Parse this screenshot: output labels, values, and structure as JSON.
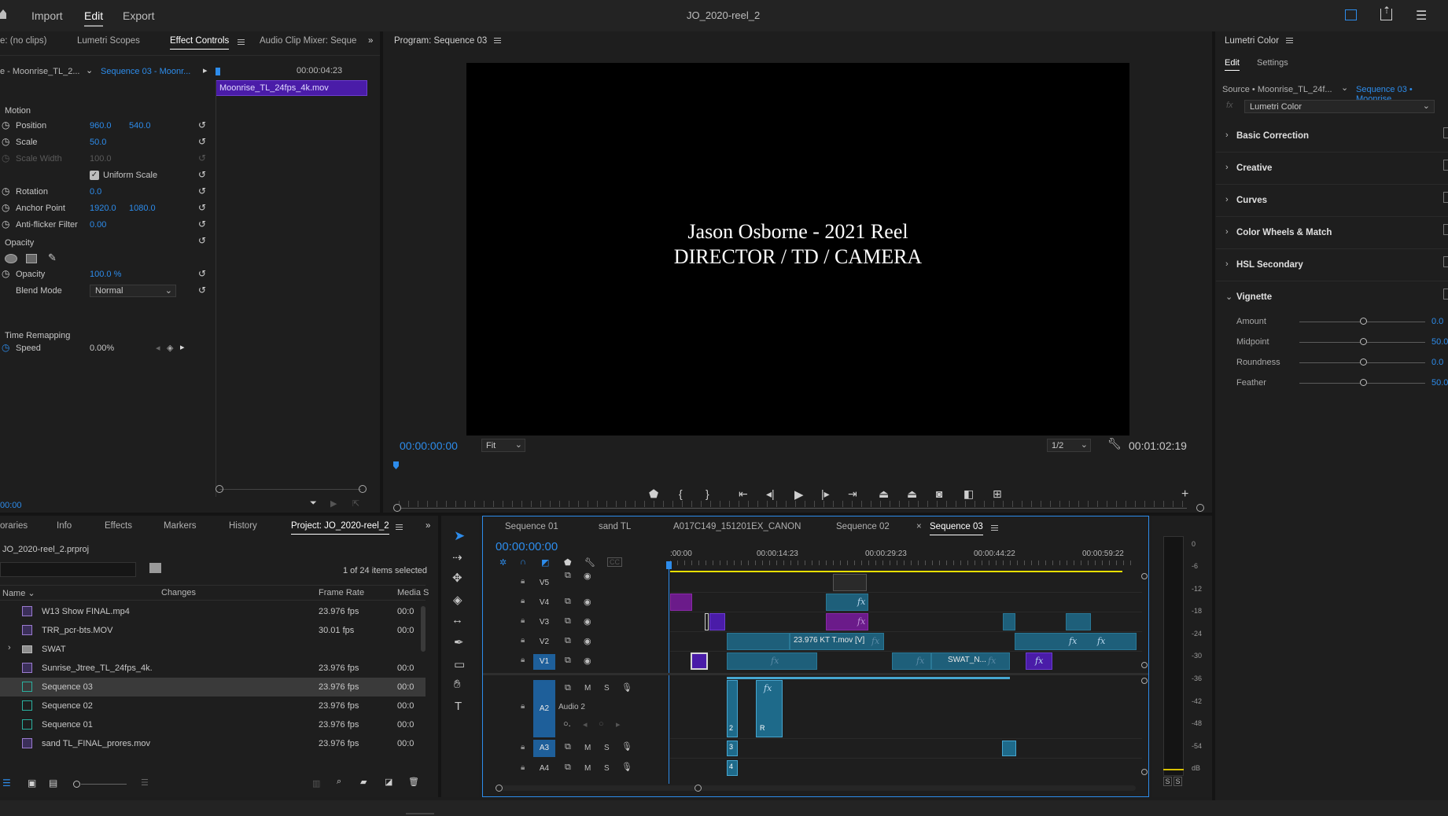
{
  "window": {
    "title": "JO_2020-reel_2",
    "nav": [
      "Import",
      "Edit",
      "Export"
    ],
    "active_nav": "Edit"
  },
  "effect_controls": {
    "tabs": [
      "e: (no clips)",
      "Lumetri Scopes",
      "Effect Controls",
      "Audio Clip Mixer: Seque"
    ],
    "source_label": "e - Moonrise_TL_2...",
    "sequence_label": "Sequence 03 - Moonr...",
    "timecode_header": "00:00:04:23",
    "clip_name": "Moonrise_TL_24fps_4k.mov",
    "motion_label": "Motion",
    "position_label": "Position",
    "position_x": "960.0",
    "position_y": "540.0",
    "scale_label": "Scale",
    "scale_value": "50.0",
    "scale_width_label": "Scale Width",
    "scale_width_value": "100.0",
    "uniform_scale_label": "Uniform Scale",
    "rotation_label": "Rotation",
    "rotation_value": "0.0",
    "anchor_label": "Anchor Point",
    "anchor_x": "1920.0",
    "anchor_y": "1080.0",
    "antiflicker_label": "Anti-flicker Filter",
    "antiflicker_value": "0.00",
    "opacity_section": "Opacity",
    "opacity_label": "Opacity",
    "opacity_value": "100.0 %",
    "blend_label": "Blend Mode",
    "blend_value": "Normal",
    "time_remap_label": "Time Remapping",
    "speed_label": "Speed",
    "speed_value": "0.00%",
    "footer_timecode": "00:00"
  },
  "program_monitor": {
    "title": "Program: Sequence 03",
    "title_line1": "Jason Osborne - 2021 Reel",
    "title_line2": "DIRECTOR / TD / CAMERA",
    "current_time": "00:00:00:00",
    "fit": "Fit",
    "resolution": "1/2",
    "duration": "00:01:02:19"
  },
  "lumetri": {
    "title": "Lumetri Color",
    "tabs": [
      "Edit",
      "Settings"
    ],
    "source": "Source • Moonrise_TL_24f...",
    "sequence": "Sequence 03 • Moonrise",
    "effect": "Lumetri Color",
    "sections": [
      "Basic Correction",
      "Creative",
      "Curves",
      "Color Wheels & Match",
      "HSL Secondary",
      "Vignette"
    ],
    "vignette": [
      {
        "name": "Amount",
        "value": "0.0"
      },
      {
        "name": "Midpoint",
        "value": "50.0"
      },
      {
        "name": "Roundness",
        "value": "0.0"
      },
      {
        "name": "Feather",
        "value": "50.0"
      }
    ]
  },
  "project": {
    "tabs": [
      "oraries",
      "Info",
      "Effects",
      "Markers",
      "History",
      "Project: JO_2020-reel_2"
    ],
    "file": "JO_2020-reel_2.prproj",
    "selection": "1 of 24 items selected",
    "columns": [
      "Name",
      "Changes",
      "Frame Rate",
      "Media S"
    ],
    "items": [
      {
        "name": "W13 Show FINAL.mp4",
        "fps": "23.976 fps",
        "media": "00:0",
        "type": "clip"
      },
      {
        "name": "TRR_pcr-bts.MOV",
        "fps": "30.01 fps",
        "media": "00:0",
        "type": "clip"
      },
      {
        "name": "SWAT",
        "fps": "",
        "media": "",
        "type": "folder"
      },
      {
        "name": "Sunrise_Jtree_TL_24fps_4k.",
        "fps": "23.976 fps",
        "media": "00:0",
        "type": "clip"
      },
      {
        "name": "Sequence 03",
        "fps": "23.976 fps",
        "media": "00:0",
        "type": "seq"
      },
      {
        "name": "Sequence 02",
        "fps": "23.976 fps",
        "media": "00:0",
        "type": "seq"
      },
      {
        "name": "Sequence 01",
        "fps": "23.976 fps",
        "media": "00:0",
        "type": "seq"
      },
      {
        "name": "sand TL_FINAL_prores.mov",
        "fps": "23.976 fps",
        "media": "00:0",
        "type": "clip"
      }
    ]
  },
  "timeline": {
    "tabs": [
      "Sequence 01",
      "sand TL",
      "A017C149_151201EX_CANON",
      "Sequence 02",
      "Sequence 03"
    ],
    "active_tab": "Sequence 03",
    "current_time": "00:00:00:00",
    "ruler": [
      ":00:00",
      "00:00:14:23",
      "00:00:29:23",
      "00:00:44:22",
      "00:00:59:22"
    ],
    "video_tracks": [
      "V5",
      "V4",
      "V3",
      "V2",
      "V1"
    ],
    "audio_tracks": [
      "A2",
      "A3",
      "A4"
    ],
    "audio2_label": "Audio 2",
    "clip_label_1": "23.976 KT T.mov [V]",
    "clip_label_2": "SWAT_N...",
    "audio_badges": [
      "2",
      "R",
      "3",
      "4"
    ],
    "fx": "fx",
    "mute": "M",
    "solo": "S"
  },
  "meter": {
    "ticks": [
      "0",
      "-6",
      "-12",
      "-18",
      "-24",
      "-30",
      "-36",
      "-42",
      "-48",
      "-54",
      "dB"
    ],
    "solo_buttons": [
      "S",
      "S"
    ]
  }
}
